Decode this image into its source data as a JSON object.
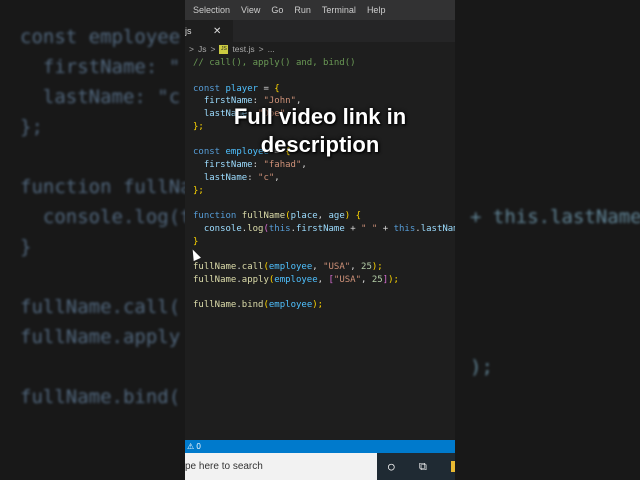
{
  "menu": [
    "Selection",
    "View",
    "Go",
    "Run",
    "Terminal",
    "Help"
  ],
  "tab": {
    "label": "js",
    "close": "✕"
  },
  "breadcrumb": {
    "folder": "Js",
    "sep": ">",
    "file": "test.js",
    "more": "..."
  },
  "code": [
    [
      [
        "// call(), apply() and, bind()",
        "c-com"
      ]
    ],
    [],
    [
      [
        "const ",
        "c-kw"
      ],
      [
        "player",
        "c-var"
      ],
      [
        " = ",
        "c-t"
      ],
      [
        "{",
        "c-p"
      ]
    ],
    [
      [
        "  firstName",
        "c-prop"
      ],
      [
        ": ",
        "c-t"
      ],
      [
        "\"John\"",
        "c-str"
      ],
      [
        ",",
        "c-t"
      ]
    ],
    [
      [
        "  lastName",
        "c-prop"
      ],
      [
        ": ",
        "c-t"
      ],
      [
        "\"Doe\"",
        "c-str"
      ],
      [
        ",",
        "c-t"
      ]
    ],
    [
      [
        "};",
        "c-p"
      ]
    ],
    [],
    [
      [
        "const ",
        "c-kw"
      ],
      [
        "employee",
        "c-var"
      ],
      [
        " = ",
        "c-t"
      ],
      [
        "{",
        "c-p"
      ]
    ],
    [
      [
        "  firstName",
        "c-prop"
      ],
      [
        ": ",
        "c-t"
      ],
      [
        "\"fahad\"",
        "c-str"
      ],
      [
        ",",
        "c-t"
      ]
    ],
    [
      [
        "  lastName",
        "c-prop"
      ],
      [
        ": ",
        "c-t"
      ],
      [
        "\"c\"",
        "c-str"
      ],
      [
        ",",
        "c-t"
      ]
    ],
    [
      [
        "};",
        "c-p"
      ]
    ],
    [],
    [
      [
        "function ",
        "c-kw"
      ],
      [
        "fullName",
        "c-fn"
      ],
      [
        "(",
        "c-p"
      ],
      [
        "place",
        "c-prop"
      ],
      [
        ", ",
        "c-t"
      ],
      [
        "age",
        "c-prop"
      ],
      [
        ") ",
        "c-p"
      ],
      [
        "{",
        "c-p"
      ]
    ],
    [
      [
        "  console",
        "c-prop"
      ],
      [
        ".",
        "c-t"
      ],
      [
        "log",
        "c-fn"
      ],
      [
        "(",
        "c-p2"
      ],
      [
        "this",
        "c-kw"
      ],
      [
        ".",
        "c-t"
      ],
      [
        "firstName",
        "c-prop"
      ],
      [
        " + ",
        "c-t"
      ],
      [
        "\" \"",
        "c-str"
      ],
      [
        " + ",
        "c-t"
      ],
      [
        "this",
        "c-kw"
      ],
      [
        ".",
        "c-t"
      ],
      [
        "lastName",
        "c-prop"
      ]
    ],
    [
      [
        "}",
        "c-p"
      ]
    ],
    [],
    [
      [
        "fullName",
        "c-fn"
      ],
      [
        ".",
        "c-t"
      ],
      [
        "call",
        "c-fn"
      ],
      [
        "(",
        "c-p"
      ],
      [
        "employee",
        "c-var"
      ],
      [
        ", ",
        "c-t"
      ],
      [
        "\"USA\"",
        "c-str"
      ],
      [
        ", ",
        "c-t"
      ],
      [
        "25",
        "c-num"
      ],
      [
        ");",
        "c-p"
      ]
    ],
    [
      [
        "fullName",
        "c-fn"
      ],
      [
        ".",
        "c-t"
      ],
      [
        "apply",
        "c-fn"
      ],
      [
        "(",
        "c-p"
      ],
      [
        "employee",
        "c-var"
      ],
      [
        ", ",
        "c-t"
      ],
      [
        "[",
        "c-p2"
      ],
      [
        "\"USA\"",
        "c-str"
      ],
      [
        ", ",
        "c-t"
      ],
      [
        "25",
        "c-num"
      ],
      [
        "]",
        "c-p2"
      ],
      [
        ");",
        "c-p"
      ]
    ],
    [],
    [
      [
        "fullName",
        "c-fn"
      ],
      [
        ".",
        "c-t"
      ],
      [
        "bind",
        "c-fn"
      ],
      [
        "(",
        "c-p"
      ],
      [
        "employee",
        "c-var"
      ],
      [
        ");",
        "c-p"
      ]
    ]
  ],
  "status": {
    "warnings": "⚠ 0"
  },
  "taskbar": {
    "search_placeholder": "pe here to search"
  },
  "caption": {
    "line1": "Full video link in",
    "line2": "description"
  },
  "blur_left": "const employee = {\n  firstName: \"\n  lastName: \"c\n};\n\nfunction fullNa\n  console.log(t\n}\n\nfullName.call(\nfullName.apply\n\nfullName.bind(",
  "blur_right": "\n\n\n\n\n\n+ this.lastName\n\n\n\n\n);"
}
